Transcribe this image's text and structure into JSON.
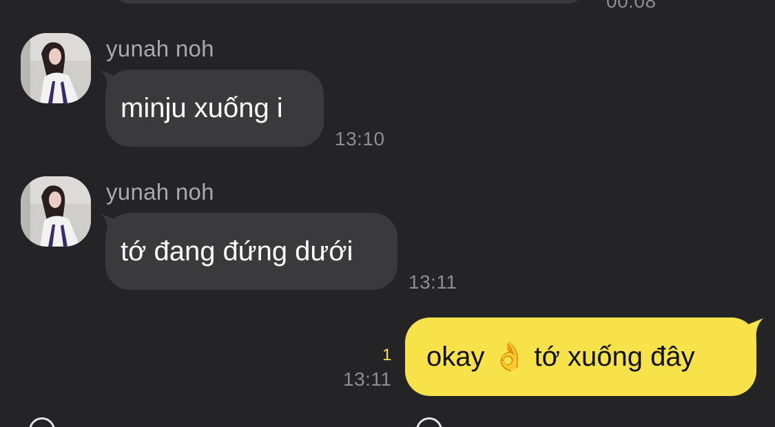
{
  "top": {
    "time": "00:08"
  },
  "messages_in": [
    {
      "sender": "yunah noh",
      "text": "minju xuống i",
      "time": "13:10"
    },
    {
      "sender": "yunah noh",
      "text": "tớ đang đứng dưới",
      "time": "13:11"
    }
  ],
  "message_out": {
    "text": "okay 👌 tớ xuống đây",
    "time": "13:11",
    "unread_count": "1"
  },
  "colors": {
    "background": "#242426",
    "incoming_bubble": "#3a3a3c",
    "outgoing_bubble": "#f7e249",
    "sender_text": "#a9a9ad",
    "timestamp": "#8e8e92"
  }
}
